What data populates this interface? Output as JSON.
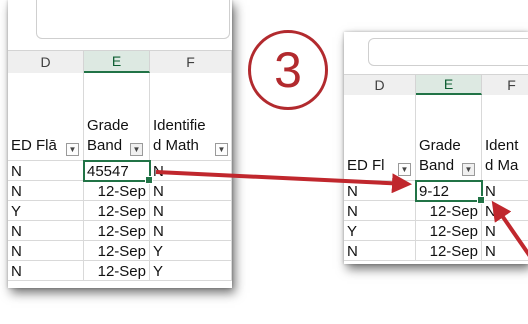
{
  "step_badge": "3",
  "left_sheet": {
    "columns": [
      "D",
      "E",
      "F"
    ],
    "selected_column": "E",
    "headers": {
      "d": "ED Flā",
      "e_line1": "Grade",
      "e_line2": "Band",
      "f_line1": "Identifie",
      "f_line2": "d Math"
    },
    "rows": [
      [
        "N",
        "45547",
        "N"
      ],
      [
        "N",
        "12-Sep",
        "N"
      ],
      [
        "Y",
        "12-Sep",
        "N"
      ],
      [
        "N",
        "12-Sep",
        "N"
      ],
      [
        "N",
        "12-Sep",
        "Y"
      ],
      [
        "N",
        "12-Sep",
        "Y"
      ]
    ]
  },
  "right_sheet": {
    "columns": [
      "D",
      "E",
      "F"
    ],
    "selected_column": "E",
    "headers": {
      "d": "ED Fl",
      "e_line1": "Grade",
      "e_line2": "Band",
      "f_line1": "Ident",
      "f_line2": "d Ma"
    },
    "rows": [
      [
        "N",
        "9-12",
        "N"
      ],
      [
        "N",
        "12-Sep",
        "N"
      ],
      [
        "Y",
        "12-Sep",
        "N"
      ],
      [
        "N",
        "12-Sep",
        "N"
      ]
    ]
  },
  "colors": {
    "accent_green": "#217346",
    "arrow_red": "#c0272d",
    "badge_red": "#b22a2e"
  },
  "icons": [
    "filter-dropdown-icon",
    "filter-active-icon",
    "arrow-annotation"
  ]
}
